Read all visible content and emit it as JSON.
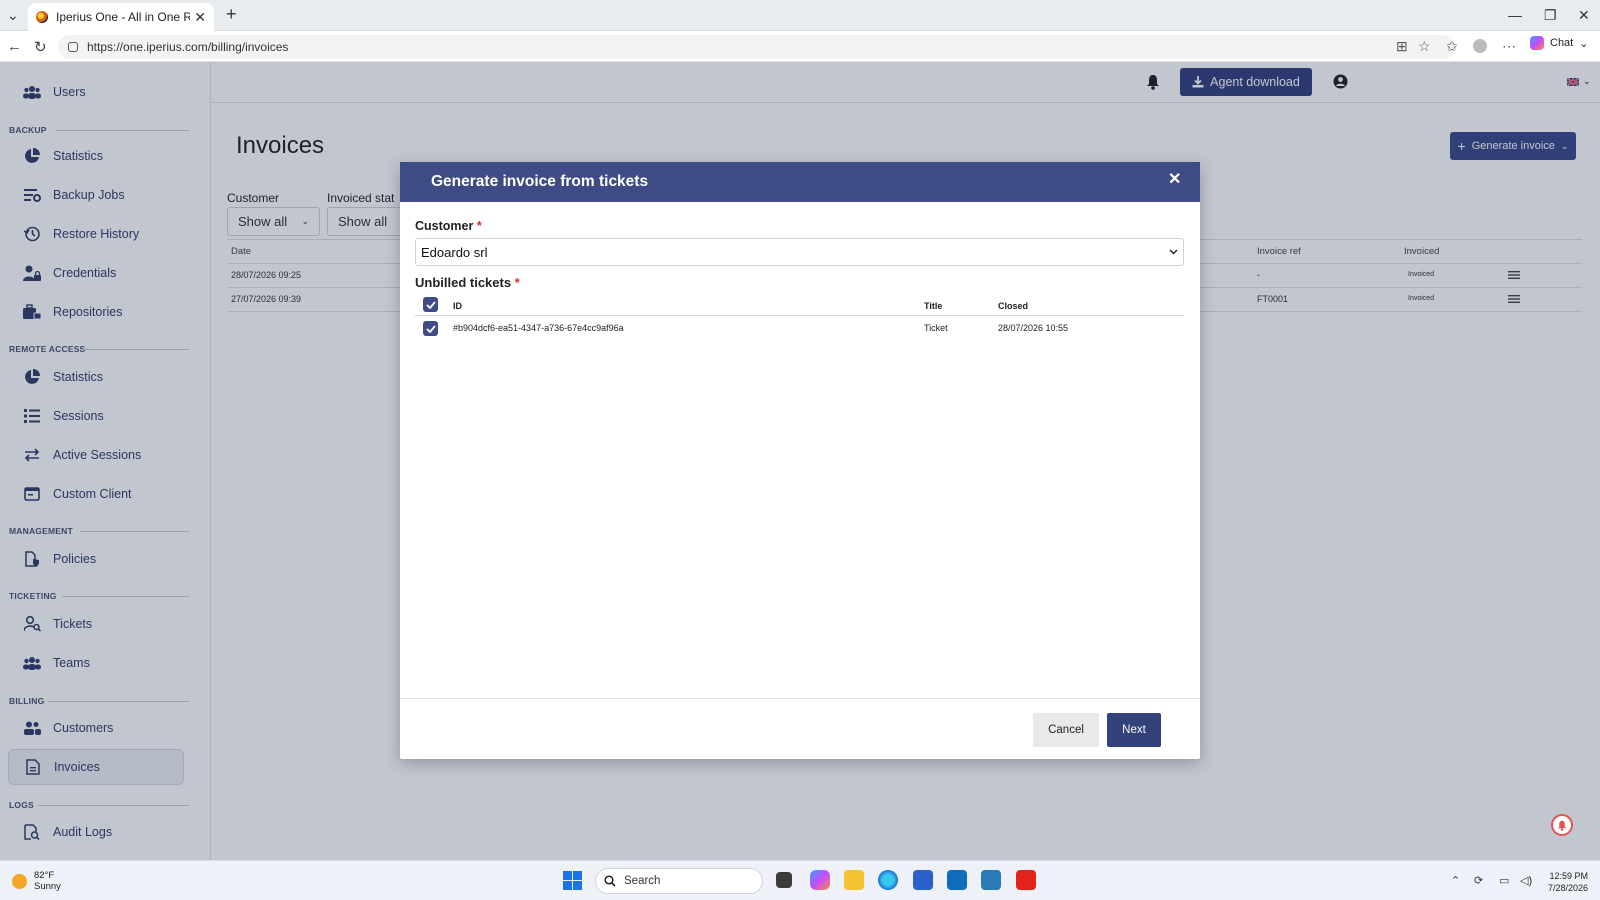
{
  "browser": {
    "tab_title": "Iperius One - All in One RMM Suite",
    "url": "https://one.iperius.com/billing/invoices",
    "chat_label": "Chat"
  },
  "sidebar": {
    "top_item": "Users",
    "sections": [
      {
        "title": "BACKUP",
        "items": [
          "Statistics",
          "Backup Jobs",
          "Restore History",
          "Credentials",
          "Repositories"
        ]
      },
      {
        "title": "REMOTE ACCESS",
        "items": [
          "Statistics",
          "Sessions",
          "Active Sessions",
          "Custom Client"
        ]
      },
      {
        "title": "MANAGEMENT",
        "items": [
          "Policies"
        ]
      },
      {
        "title": "TICKETING",
        "items": [
          "Tickets",
          "Teams"
        ]
      },
      {
        "title": "BILLING",
        "items": [
          "Customers",
          "Invoices"
        ]
      },
      {
        "title": "LOGS",
        "items": [
          "Audit Logs"
        ]
      }
    ],
    "active_item": "Invoices"
  },
  "header": {
    "agent_download": "Agent download"
  },
  "page": {
    "title": "Invoices",
    "generate_button": "Generate invoice",
    "filters": [
      {
        "label": "Customer",
        "value": "Show all"
      },
      {
        "label": "Invoiced stat",
        "value": "Show all"
      }
    ],
    "table": {
      "headers": {
        "date": "Date",
        "invoice_ref": "Invoice ref",
        "invoiced": "Invoiced"
      },
      "rows": [
        {
          "date": "28/07/2026 09:25",
          "invoice_ref": "-",
          "invoiced": "Invoiced"
        },
        {
          "date": "27/07/2026 09:39",
          "invoice_ref": "FT0001",
          "invoiced": "Invoiced"
        }
      ]
    }
  },
  "modal": {
    "title": "Generate invoice from tickets",
    "customer_label": "Customer",
    "customer_value": "Edoardo srl",
    "tickets_label": "Unbilled tickets",
    "required_mark": "*",
    "columns": {
      "id": "ID",
      "title": "Title",
      "closed": "Closed"
    },
    "tickets": [
      {
        "id": "#b904dcf6-ea51-4347-a736-67e4cc9af96a",
        "title": "Ticket",
        "closed": "28/07/2026 10:55",
        "checked": true
      }
    ],
    "cancel": "Cancel",
    "next": "Next"
  },
  "taskbar": {
    "temperature": "82°F",
    "condition": "Sunny",
    "search_placeholder": "Search",
    "time": "12:59 PM",
    "date": "7/28/2026"
  },
  "colors": {
    "primary": "#3e4b84",
    "sidebar_text": "#33406a",
    "required": "#d9302c"
  }
}
